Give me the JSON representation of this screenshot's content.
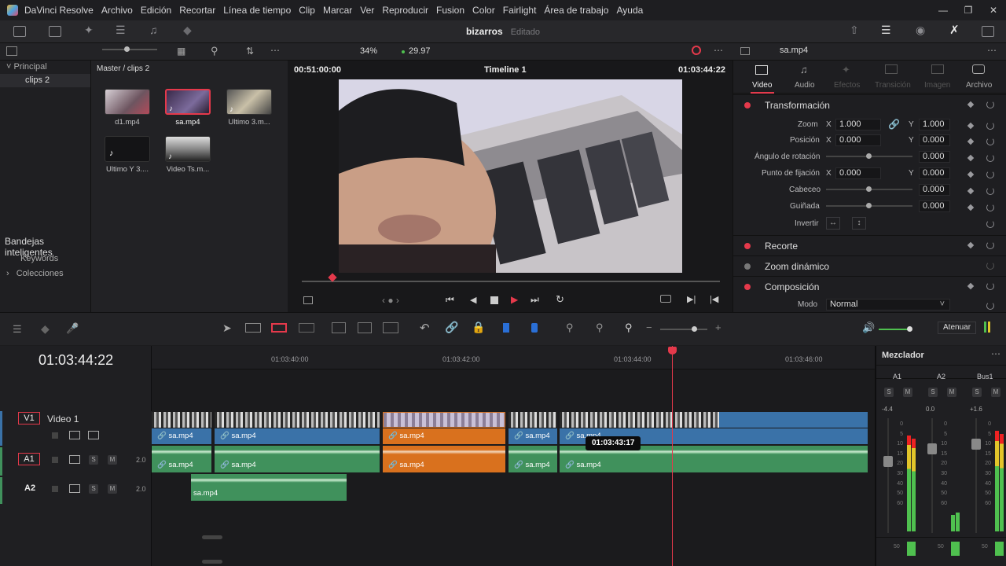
{
  "menubar": {
    "app_name": "DaVinci Resolve",
    "items": [
      "Archivo",
      "Edición",
      "Recortar",
      "Línea de tiempo",
      "Clip",
      "Marcar",
      "Ver",
      "Reproducir",
      "Fusion",
      "Color",
      "Fairlight",
      "Área de trabajo",
      "Ayuda"
    ]
  },
  "project": {
    "name": "bizarros",
    "status": "Editado"
  },
  "viewer_bar": {
    "zoom": "34%",
    "fps": "29.97"
  },
  "media_pool": {
    "tree": {
      "root": "Principal",
      "child": "clips 2"
    },
    "breadcrumb": "Master / clips 2",
    "smart_bins_title": "Bandejas inteligentes",
    "smart_bins": [
      "Keywords",
      "Colecciones"
    ],
    "clips": [
      {
        "label": "d1.mp4"
      },
      {
        "label": "sa.mp4"
      },
      {
        "label": "Ultimo 3.m..."
      },
      {
        "label": "Ultimo Y 3...."
      },
      {
        "label": "Video Ts.m..."
      }
    ]
  },
  "viewer": {
    "timecode_left": "00:51:00:00",
    "timeline_name": "Timeline 1",
    "timecode_right": "01:03:44:22"
  },
  "inspector": {
    "clip_name": "sa.mp4",
    "tabs": [
      "Video",
      "Audio",
      "Efectos",
      "Transición",
      "Imagen",
      "Archivo"
    ],
    "section_transform": "Transformación",
    "zoom_label": "Zoom",
    "zoom_x": "1.000",
    "zoom_y": "1.000",
    "position_label": "Posición",
    "pos_x": "0.000",
    "pos_y": "0.000",
    "rotation_label": "Ángulo de rotación",
    "rotation": "0.000",
    "anchor_label": "Punto de fijación",
    "anchor_x": "0.000",
    "anchor_y": "0.000",
    "pitch_label": "Cabeceo",
    "pitch": "0.000",
    "yaw_label": "Guiñada",
    "yaw": "0.000",
    "flip_label": "Invertir",
    "x_label": "X",
    "y_label": "Y",
    "section_crop": "Recorte",
    "section_dynamic_zoom": "Zoom dinámico",
    "section_composite": "Composición",
    "mode_label": "Modo",
    "mode_value": "Normal"
  },
  "timeline": {
    "timecode": "01:03:44:22",
    "ruler": [
      "01:03:40:00",
      "01:03:42:00",
      "01:03:44:00",
      "01:03:46:00"
    ],
    "hover_timecode": "01:03:43:17",
    "v1": {
      "id": "V1",
      "name": "Video 1"
    },
    "a1": {
      "id": "A1",
      "level": "2.0"
    },
    "a2": {
      "id": "A2",
      "level": "2.0"
    },
    "clip_label": "sa.mp4",
    "mute_label": "Atenuar"
  },
  "mixer": {
    "title": "Mezclador",
    "channels": [
      "A1",
      "A2",
      "Bus1"
    ],
    "levels": [
      "-4.4",
      "0.0",
      "+1.6"
    ],
    "scale": [
      "0",
      "5",
      "10",
      "15",
      "20",
      "30",
      "40",
      "50",
      "60"
    ],
    "bottom_scale": "50"
  },
  "colors": {
    "accent_red": "#e5394b",
    "video_clip": "#3a72a8",
    "audio_clip": "#40915c",
    "selected_clip": "#d9711e"
  }
}
